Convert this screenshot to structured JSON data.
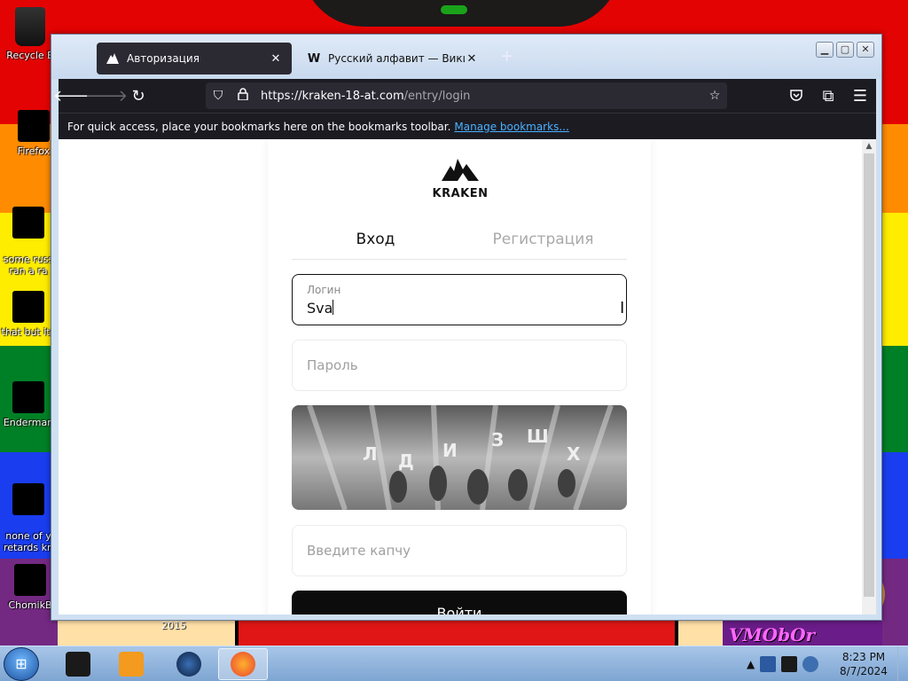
{
  "desktop": {
    "icons": [
      {
        "label": "Recycle B"
      },
      {
        "label": "Firefox"
      },
      {
        "label": "some russ\nran a ra"
      },
      {
        "label": "that but its"
      },
      {
        "label": "Enderman"
      },
      {
        "label": "none of y\nretards kn"
      },
      {
        "label": "ChomikB"
      }
    ],
    "overlay_text": "VMObOr",
    "year_text": "2015"
  },
  "browser": {
    "tabs": [
      {
        "title": "Авторизация",
        "favicon": "kraken-icon",
        "active": true
      },
      {
        "title": "Русский алфавит — Википеди",
        "favicon": "W",
        "active": false
      }
    ],
    "new_tab": "+",
    "url_host": "https://kraken-18-at.com",
    "url_path": "/entry/login",
    "bookmarks_message": "For quick access, place your bookmarks here on the bookmarks toolbar.",
    "bookmarks_link": "Manage bookmarks..."
  },
  "page": {
    "logo_text": "KRAKEN",
    "tab_login": "Вход",
    "tab_register": "Регистрация",
    "login_label": "Логин",
    "login_value": "Sva",
    "password_placeholder": "Пароль",
    "captcha_placeholder": "Введите капчу",
    "captcha_letters": [
      "Л",
      "Д",
      "И",
      "З",
      "Ш",
      "Х"
    ],
    "submit_label": "Войти"
  },
  "taskbar": {
    "time": "8:23 PM",
    "date": "8/7/2024",
    "tray_arrow": "▲"
  },
  "colors": {
    "accent_button": "#0c0c0c",
    "link": "#4ab1ff",
    "browser_dark": "#1c1b22"
  }
}
